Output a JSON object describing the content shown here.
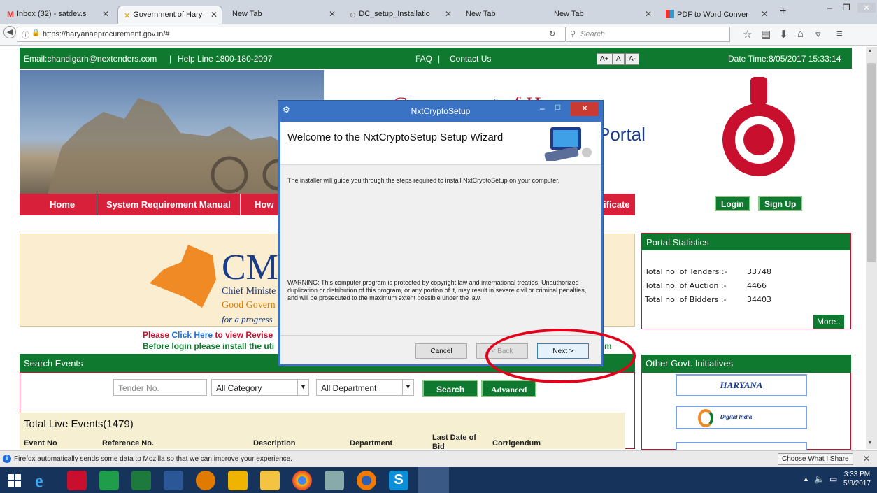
{
  "browser": {
    "tabs": [
      {
        "label": "Inbox (32) - satdev.s",
        "icon": "gmail-icon"
      },
      {
        "label": "Government of Hary",
        "icon": "site-icon"
      },
      {
        "label": "New Tab"
      },
      {
        "label": "DC_setup_Installatio",
        "icon": "download-icon"
      },
      {
        "label": "New Tab"
      },
      {
        "label": "New Tab"
      },
      {
        "label": "PDF to Word Conver",
        "icon": "pdf-icon"
      }
    ],
    "url": "https://haryanaeprocurement.gov.in/#",
    "search_placeholder": "Search"
  },
  "site": {
    "email": "Email:chandigarh@nextenders.com",
    "helpline": "Help Line 1800-180-2097",
    "faq": "FAQ",
    "contact": "Contact Us",
    "font_buttons": [
      "A+",
      "A",
      "A-"
    ],
    "datetime": "Date Time:8/05/2017 15:33:14",
    "title": "Government of Haryana",
    "portal": "Portal",
    "menu": [
      "Home",
      "System Requirement Manual",
      "How",
      "ificate"
    ],
    "login": "Login",
    "signup": "Sign Up",
    "cm_big": "CM",
    "cm_lines": [
      "Chief Ministe",
      "Good Govern",
      "for a progress"
    ],
    "notice1_a": "Please ",
    "notice1_link": "Click Here",
    "notice1_b": " to view Revise",
    "notice2": "Before login please install the uti",
    "notice2_end": "m",
    "stats": {
      "title": "Portal Statistics",
      "rows": [
        {
          "label": "Total no. of Tenders :-",
          "value": "33748"
        },
        {
          "label": "Total no. of Auction :-",
          "value": "4466"
        },
        {
          "label": "Total no. of Bidders :-",
          "value": "34403"
        }
      ],
      "more": "More.."
    },
    "search": {
      "title": "Search Events",
      "tender_placeholder": "Tender No.",
      "category": "All Category",
      "department": "All Department",
      "search_btn": "Search",
      "advanced_btn": "Advanced"
    },
    "initiatives_title": "Other Govt. Initiatives",
    "initiatives": [
      "HARYANA",
      "Digital India"
    ],
    "live": {
      "title": "Total Live Events(1479)",
      "columns": [
        "Event No",
        "Reference No.",
        "Description",
        "Department",
        "Last Date of Bid Submission",
        "Corrigendum"
      ]
    }
  },
  "dialog": {
    "title": "NxtCryptoSetup",
    "welcome": "Welcome to the NxtCryptoSetup Setup Wizard",
    "intro": "The installer will guide you through the steps required to install NxtCryptoSetup on your computer.",
    "warning": "WARNING: This computer program is protected by copyright law and international treaties. Unauthorized duplication or distribution of this program, or any portion of it, may result in severe civil or criminal penalties, and will be prosecuted to the maximum extent possible under the law.",
    "cancel": "Cancel",
    "back": "< Back",
    "next": "Next >"
  },
  "notice_bar": {
    "text": "Firefox automatically sends some data to Mozilla so that we can improve your experience.",
    "button": "Choose What I Share"
  },
  "taskbar": {
    "time": "3:33 PM",
    "date": "5/8/2017"
  },
  "colors": {
    "green": "#0f7a2f",
    "red": "#d8203a",
    "dialog": "#3a73c4",
    "taskbar": "#16335c"
  }
}
